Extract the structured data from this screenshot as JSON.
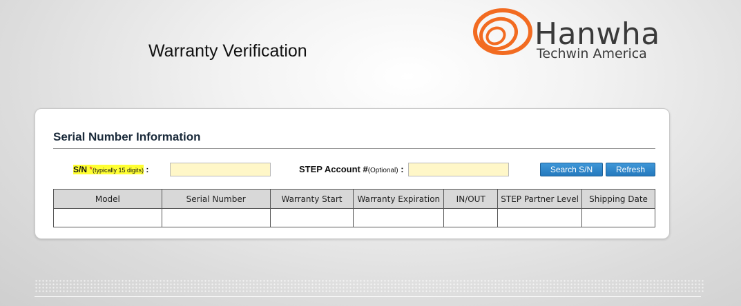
{
  "header": {
    "title": "Warranty Verification",
    "logo": {
      "name": "Hanwha",
      "subtitle": "Techwin America",
      "color": "#f26b21"
    }
  },
  "panel": {
    "section_title": "Serial Number Information",
    "sn": {
      "label": "S/N",
      "required_mark": "*",
      "note": "(typically 15 digits)",
      "colon": ":",
      "value": "",
      "highlight_color": "#ffff33"
    },
    "step": {
      "label": "STEP Account #",
      "optional": "(Optional)",
      "colon": ":",
      "value": ""
    },
    "buttons": {
      "search": "Search S/N",
      "refresh": "Refresh",
      "color": "#2f86cc"
    },
    "table": {
      "columns": [
        "Model",
        "Serial Number",
        "Warranty Start",
        "Warranty Expiration",
        "IN/OUT",
        "STEP Partner Level",
        "Shipping Date"
      ],
      "rows": [
        [
          "",
          "",
          "",
          "",
          "",
          "",
          ""
        ]
      ]
    }
  }
}
